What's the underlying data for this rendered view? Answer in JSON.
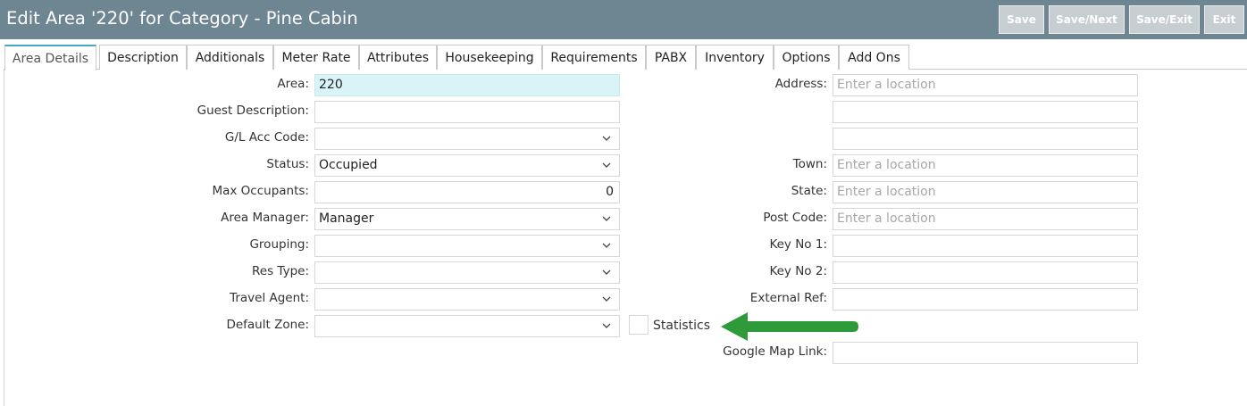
{
  "page": {
    "title": "Edit Area '220' for Category - Pine Cabin"
  },
  "toolbar": {
    "save_label": "Save",
    "save_next_label": "Save/Next",
    "save_exit_label": "Save/Exit",
    "exit_label": "Exit"
  },
  "tabs": [
    {
      "label": "Area Details"
    },
    {
      "label": "Description"
    },
    {
      "label": "Additionals"
    },
    {
      "label": "Meter Rate"
    },
    {
      "label": "Attributes"
    },
    {
      "label": "Housekeeping"
    },
    {
      "label": "Requirements"
    },
    {
      "label": "PABX"
    },
    {
      "label": "Inventory"
    },
    {
      "label": "Options"
    },
    {
      "label": "Add Ons"
    }
  ],
  "left_form": {
    "area": {
      "label": "Area:",
      "value": "220"
    },
    "guest_description": {
      "label": "Guest Description:",
      "value": ""
    },
    "gl_acc_code": {
      "label": "G/L Acc Code:",
      "value": ""
    },
    "status": {
      "label": "Status:",
      "value": "Occupied"
    },
    "max_occupants": {
      "label": "Max Occupants:",
      "value": "0"
    },
    "area_manager": {
      "label": "Area Manager:",
      "value": "Manager"
    },
    "grouping": {
      "label": "Grouping:",
      "value": ""
    },
    "res_type": {
      "label": "Res Type:",
      "value": ""
    },
    "travel_agent": {
      "label": "Travel Agent:",
      "value": ""
    },
    "default_zone": {
      "label": "Default Zone:",
      "value": ""
    }
  },
  "statistics": {
    "label": "Statistics",
    "checked": false
  },
  "right_form": {
    "address": {
      "label": "Address:",
      "placeholder": "Enter a location"
    },
    "town": {
      "label": "Town:",
      "placeholder": "Enter a location"
    },
    "state": {
      "label": "State:",
      "placeholder": "Enter a location"
    },
    "post_code": {
      "label": "Post Code:",
      "placeholder": "Enter a location"
    },
    "key_no_1": {
      "label": "Key No 1:",
      "value": ""
    },
    "key_no_2": {
      "label": "Key No 2:",
      "value": ""
    },
    "external_ref": {
      "label": "External Ref:",
      "value": ""
    },
    "google_map_link": {
      "label": "Google Map Link:",
      "value": ""
    }
  },
  "colors": {
    "header_bg": "#6e8592",
    "button_bg": "#c7ced2",
    "highlight_field": "#d9f4f7",
    "active_tab_accent": "#4aa8c0",
    "annotation_arrow": "#2e9a3a"
  },
  "icons": {
    "dropdown": "chevron-down-icon",
    "annotation": "arrow-left-icon"
  }
}
